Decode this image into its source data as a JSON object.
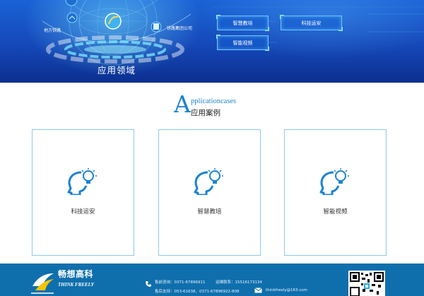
{
  "hero": {
    "title": "应用领域",
    "node_left": "地方铁路",
    "node_right": "铁路集团公司",
    "buttons": [
      "智慧教培",
      "科技运安",
      "智能视频"
    ]
  },
  "section": {
    "initial": "A",
    "english": "pplicationcases",
    "chinese": "应用案例"
  },
  "cards": [
    {
      "label": "科技运安",
      "icon": "head-lightbulb-icon"
    },
    {
      "label": "智慧教培",
      "icon": "head-lightbulb-icon"
    },
    {
      "label": "智能视频",
      "icon": "head-lightbulb-icon"
    }
  ],
  "footer": {
    "logo_cn": "畅想高科",
    "logo_en": "THINK FREELY",
    "sales_line": "售前咨询：0371-67896911",
    "ops_line": "运维联系：15516173134",
    "support_line": "售后支持：053-61638、0371-67896922-808",
    "email": "thinkfreely@163.com"
  },
  "colors": {
    "accent": "#1b83cf",
    "card_border": "#8ec8ee",
    "footer_bg": "#0f6fac",
    "hero_bg": "#1548b8"
  }
}
